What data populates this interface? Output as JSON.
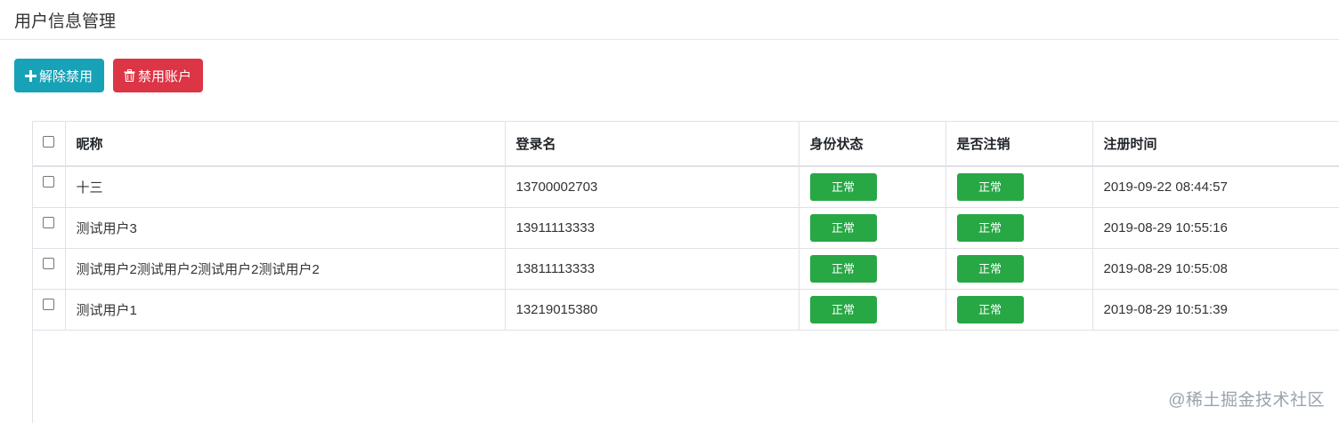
{
  "header": {
    "title": "用户信息管理"
  },
  "toolbar": {
    "enable_label": "解除禁用",
    "enable_icon": "plus-icon",
    "disable_label": "禁用账户",
    "disable_icon": "trash-icon",
    "enable_color": "#17a2b8",
    "disable_color": "#dc3545"
  },
  "table": {
    "columns": [
      "昵称",
      "登录名",
      "身份状态",
      "是否注销",
      "注册时间"
    ],
    "rows": [
      {
        "nickname": "十三",
        "login": "13700002703",
        "status": "正常",
        "cancelled": "正常",
        "registered": "2019-09-22 08:44:57"
      },
      {
        "nickname": "测试用户3",
        "login": "13911113333",
        "status": "正常",
        "cancelled": "正常",
        "registered": "2019-08-29 10:55:16"
      },
      {
        "nickname": "测试用户2测试用户2测试用户2测试用户2",
        "login": "13811113333",
        "status": "正常",
        "cancelled": "正常",
        "registered": "2019-08-29 10:55:08"
      },
      {
        "nickname": "测试用户1",
        "login": "13219015380",
        "status": "正常",
        "cancelled": "正常",
        "registered": "2019-08-29 10:51:39"
      }
    ],
    "badge_color": "#28a745"
  },
  "watermark": "@稀土掘金技术社区"
}
